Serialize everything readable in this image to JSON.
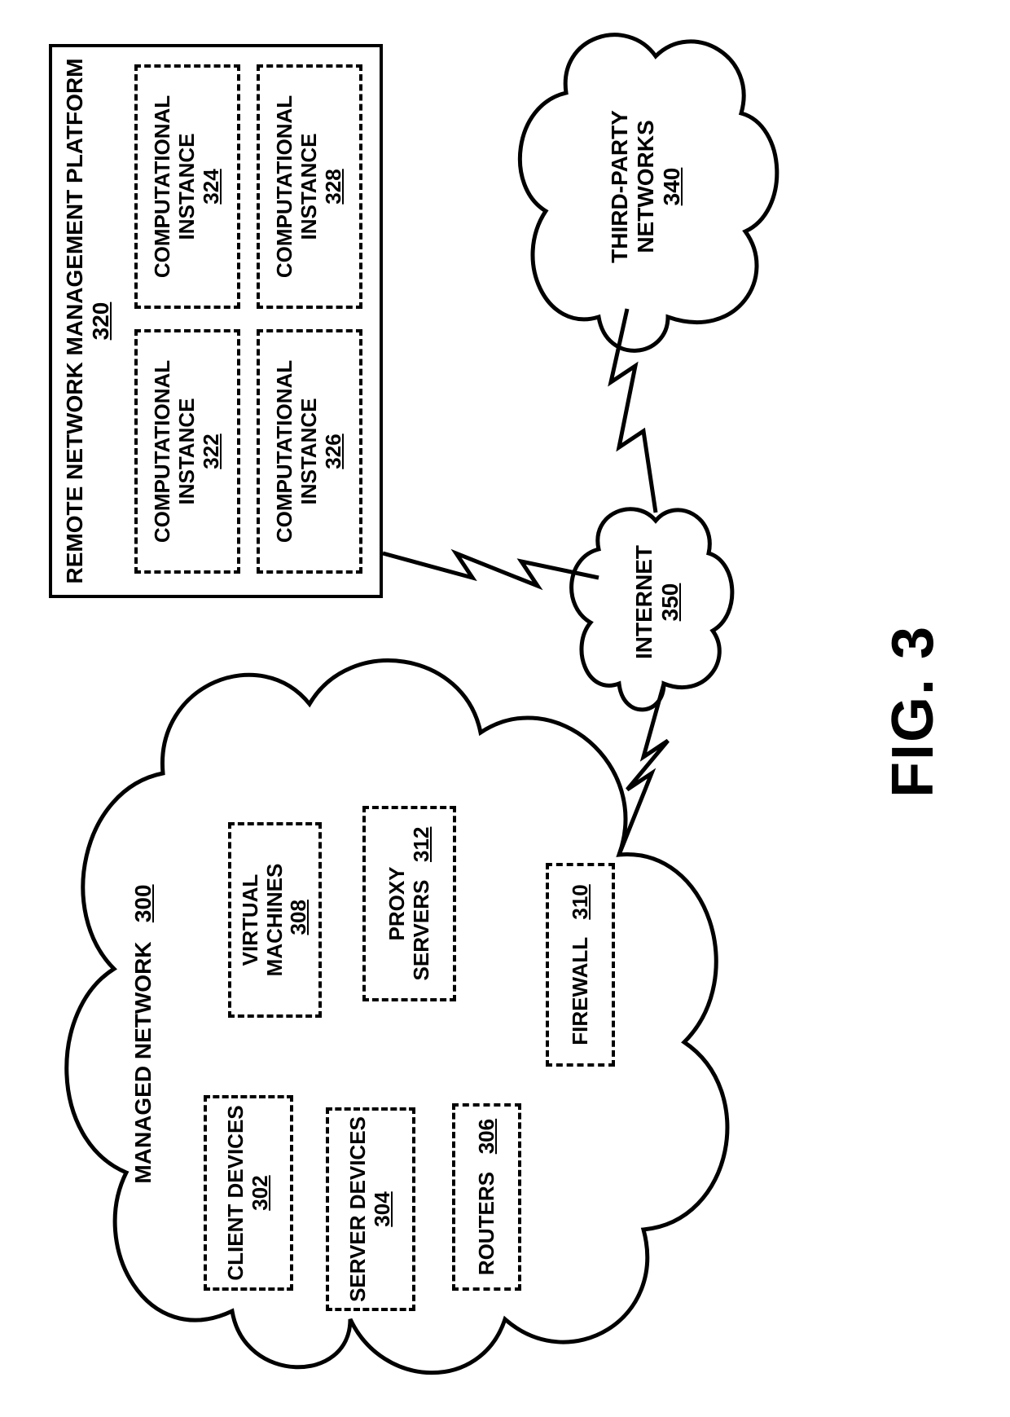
{
  "figure_caption": "FIG. 3",
  "managed_network": {
    "title": "MANAGED NETWORK",
    "num": "300",
    "blocks": {
      "client_devices": {
        "label": "CLIENT DEVICES",
        "num": "302"
      },
      "server_devices": {
        "label": "SERVER DEVICES",
        "num": "304"
      },
      "routers": {
        "label": "ROUTERS",
        "num": "306"
      },
      "virtual_machines": {
        "label": "VIRTUAL MACHINES",
        "num": "308"
      },
      "proxy_servers": {
        "label": "PROXY SERVERS",
        "num": "312"
      },
      "firewall": {
        "label": "FIREWALL",
        "num": "310"
      }
    }
  },
  "remote_platform": {
    "title": "REMOTE NETWORK MANAGEMENT PLATFORM",
    "num": "320",
    "instances": {
      "a": {
        "label": "COMPUTATIONAL INSTANCE",
        "num": "322"
      },
      "b": {
        "label": "COMPUTATIONAL INSTANCE",
        "num": "324"
      },
      "c": {
        "label": "COMPUTATIONAL INSTANCE",
        "num": "326"
      },
      "d": {
        "label": "COMPUTATIONAL INSTANCE",
        "num": "328"
      }
    }
  },
  "internet": {
    "title": "INTERNET",
    "num": "350"
  },
  "third_party": {
    "title": "THIRD-PARTY NETWORKS",
    "num": "340"
  }
}
